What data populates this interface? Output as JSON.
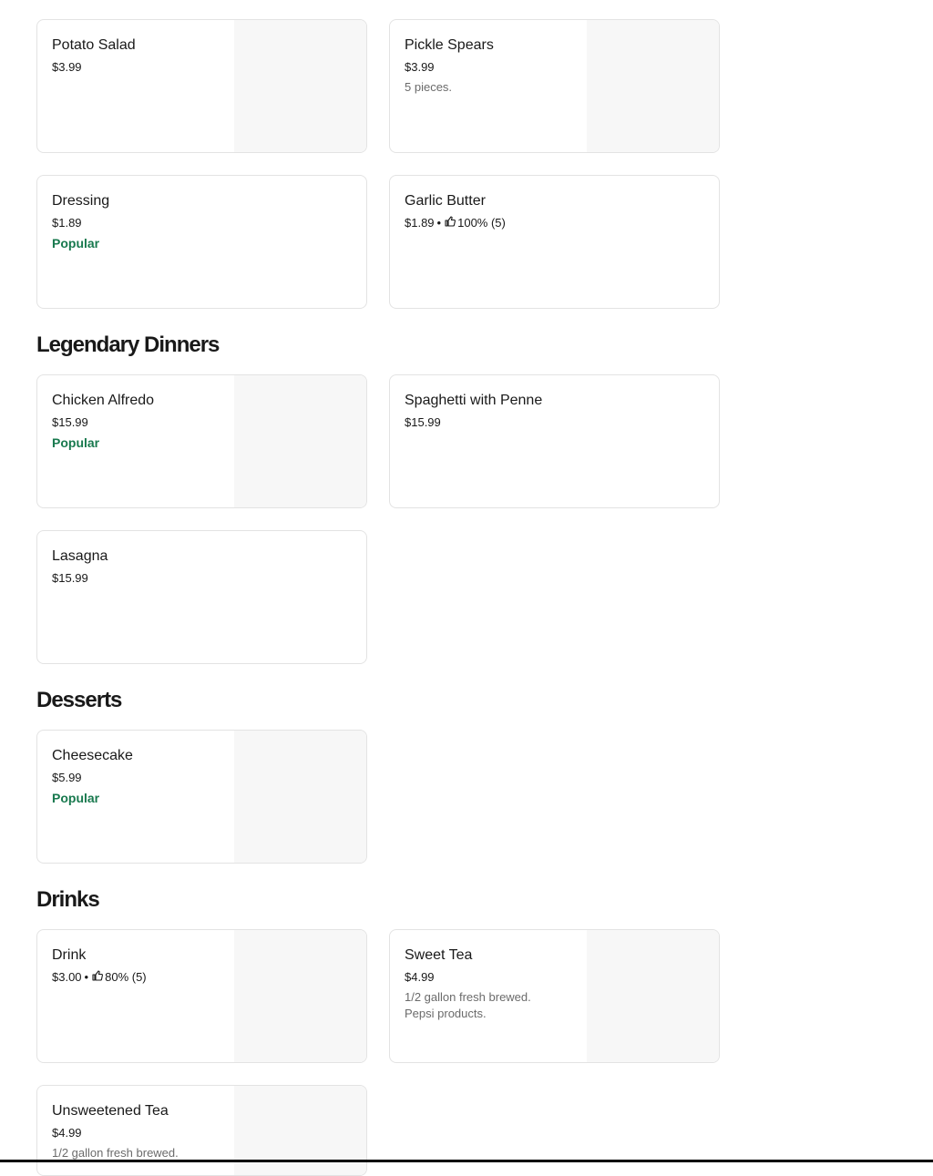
{
  "sections": {
    "dinners_title": "Legendary Dinners",
    "desserts_title": "Desserts",
    "drinks_title": "Drinks"
  },
  "items": {
    "potato_salad": {
      "name": "Potato Salad",
      "price": "$3.99"
    },
    "pickle_spears": {
      "name": "Pickle Spears",
      "price": "$3.99",
      "desc": "5 pieces."
    },
    "dressing": {
      "name": "Dressing",
      "price": "$1.89",
      "badge": "Popular"
    },
    "garlic_butter": {
      "name": "Garlic Butter",
      "price": "$1.89",
      "sep": "•",
      "rating": "100% (5)"
    },
    "chicken_alfredo": {
      "name": "Chicken Alfredo",
      "price": "$15.99",
      "badge": "Popular"
    },
    "spaghetti_penne": {
      "name": "Spaghetti with Penne",
      "price": "$15.99"
    },
    "lasagna": {
      "name": "Lasagna",
      "price": "$15.99"
    },
    "cheesecake": {
      "name": "Cheesecake",
      "price": "$5.99",
      "badge": "Popular"
    },
    "drink": {
      "name": "Drink",
      "price": "$3.00",
      "sep": "•",
      "rating": "80% (5)"
    },
    "sweet_tea": {
      "name": "Sweet Tea",
      "price": "$4.99",
      "desc_line1": "1/2 gallon fresh brewed.",
      "desc_line2": "Pepsi products."
    },
    "unsweetened_tea": {
      "name": "Unsweetened Tea",
      "price": "$4.99",
      "desc": "1/2 gallon fresh brewed."
    }
  },
  "icons": {
    "rating": "thumbs-up-icon"
  },
  "colors": {
    "popular": "#18794e",
    "border": "#e3e3e3",
    "image_placeholder": "#f7f7f7"
  }
}
